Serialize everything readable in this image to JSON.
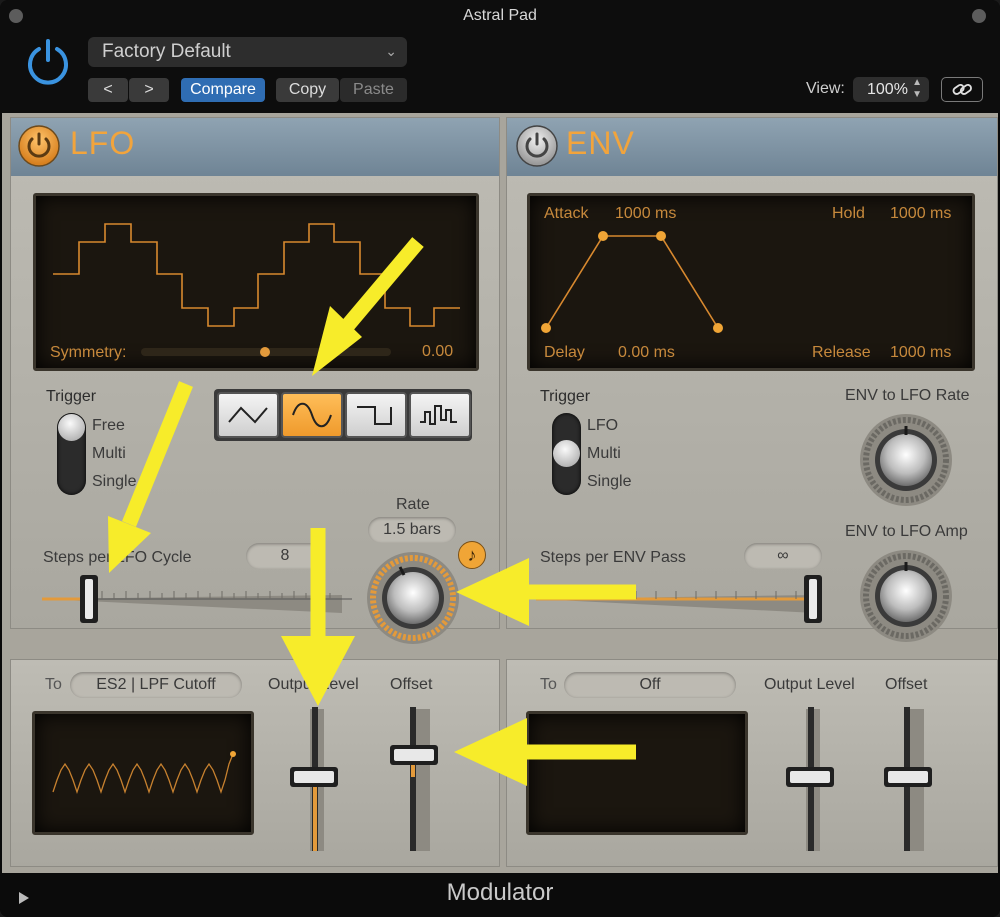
{
  "window": {
    "title": "Astral Pad",
    "footer_title": "Modulator"
  },
  "header": {
    "preset": "Factory Default",
    "prev_label": "<",
    "next_label": ">",
    "compare_label": "Compare",
    "copy_label": "Copy",
    "paste_label": "Paste",
    "view_label": "View:",
    "zoom": "100%"
  },
  "lfo": {
    "title": "LFO",
    "symmetry_label": "Symmetry:",
    "symmetry_value": "0.00",
    "trigger_label": "Trigger",
    "trigger_options": [
      "Free",
      "Multi",
      "Single"
    ],
    "trigger_selected": "Free",
    "waveforms": [
      "triangle",
      "sine",
      "square",
      "random"
    ],
    "waveform_selected": "sine",
    "steps_label": "Steps per LFO Cycle",
    "steps_value": "8",
    "rate_label": "Rate",
    "rate_value": "1.5 bars",
    "note_icon": "♪"
  },
  "env": {
    "title": "ENV",
    "attack_label": "Attack",
    "attack_value": "1000 ms",
    "hold_label": "Hold",
    "hold_value": "1000 ms",
    "delay_label": "Delay",
    "delay_value": "0.00 ms",
    "release_label": "Release",
    "release_value": "1000 ms",
    "trigger_label": "Trigger",
    "trigger_options": [
      "LFO",
      "Multi",
      "Single"
    ],
    "trigger_selected": "Multi",
    "lfo_rate_label": "ENV to LFO Rate",
    "lfo_amp_label": "ENV to LFO Amp",
    "steps_label": "Steps per ENV Pass",
    "steps_value": "∞"
  },
  "lfo_output": {
    "to_label": "To",
    "target": "ES2 | LPF Cutoff",
    "output_level_label": "Output Level",
    "offset_label": "Offset"
  },
  "env_output": {
    "to_label": "To",
    "target": "Off",
    "output_level_label": "Output Level",
    "offset_label": "Offset"
  },
  "colors": {
    "accent": "#f2a43c",
    "arrow": "#f7ec2a",
    "compare": "#2f6db3"
  }
}
